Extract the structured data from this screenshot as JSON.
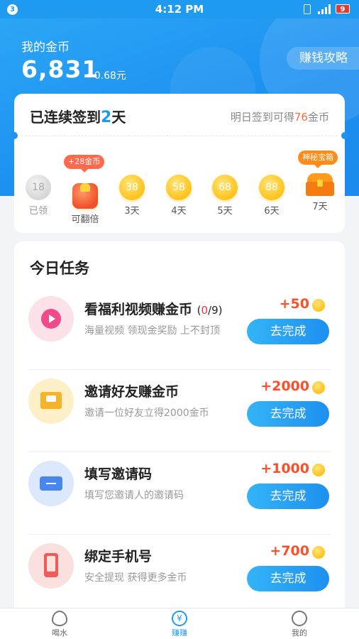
{
  "status_bar": {
    "notification_count": "3",
    "time": "4:12 PM",
    "battery": "9",
    "icons": [
      "vibrate-icon",
      "signal-icon",
      "battery-icon"
    ]
  },
  "header": {
    "title": "我的金币",
    "coin_amount": "6,831",
    "approx_value": "≈0.68元",
    "guide_button": "赚钱攻略"
  },
  "checkin": {
    "title_prefix": "已连续签到",
    "streak_days": "2",
    "title_suffix": "天",
    "tip_prefix": "明日签到可得",
    "tip_amount": "76",
    "tip_suffix": "金币",
    "bonus_tag": "+28金币",
    "chest_tag": "神秘宝箱",
    "days": [
      {
        "value": "18",
        "label": "已领"
      },
      {
        "value": "",
        "label": "可翻倍"
      },
      {
        "value": "38",
        "label": "3天"
      },
      {
        "value": "58",
        "label": "4天"
      },
      {
        "value": "68",
        "label": "5天"
      },
      {
        "value": "88",
        "label": "6天"
      },
      {
        "value": "",
        "label": "7天"
      }
    ]
  },
  "tasks": {
    "heading": "今日任务",
    "button_label": "去完成",
    "items": [
      {
        "title": "看福利视频赚金币",
        "progress_open": "(",
        "progress_done": "0",
        "progress_total": "/9)",
        "desc": "海量视频 领现金奖励 上不封顶",
        "reward": "+50",
        "icon": "play-icon"
      },
      {
        "title": "邀请好友赚金币",
        "desc": "邀请一位好友立得2000金币",
        "reward": "+2000",
        "icon": "envelope-icon"
      },
      {
        "title": "填写邀请码",
        "desc": "填写您邀请人的邀请码",
        "reward": "+1000",
        "icon": "ticket-icon"
      },
      {
        "title": "绑定手机号",
        "desc": "安全提现 获得更多金币",
        "reward": "+700",
        "icon": "phone-icon"
      }
    ]
  },
  "tabbar": {
    "items": [
      {
        "label": "喝水",
        "icon": "water-drop-icon"
      },
      {
        "label": "赚赚",
        "icon": "yuan-coin-icon",
        "active": true
      },
      {
        "label": "我的",
        "icon": "user-icon"
      }
    ],
    "active_symbol": "¥"
  },
  "colors": {
    "primary": "#1e9bf0",
    "reward": "#ff4e2a",
    "coin": "#ffc21a"
  }
}
